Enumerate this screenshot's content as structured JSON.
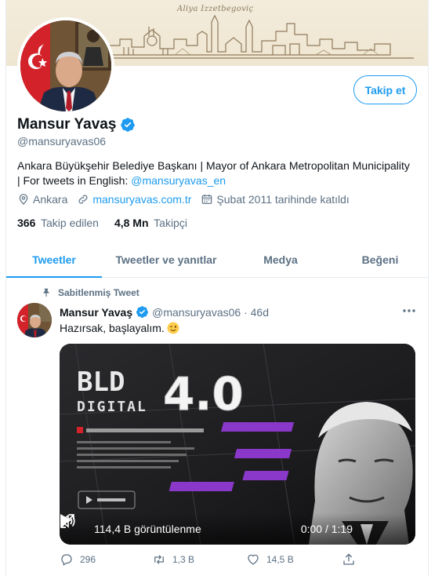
{
  "banner": {
    "caption": "Aliya Izzetbegoviç"
  },
  "profile": {
    "name": "Mansur Yavaş",
    "handle": "@mansuryavas06",
    "follow_label": "Takip et",
    "bio_text": "Ankara Büyükşehir Belediye Başkanı | Mayor of Ankara Metropolitan Municipality | For tweets in English: ",
    "bio_link": "@mansuryavas_en",
    "location": "Ankara",
    "website": "mansuryavas.com.tr",
    "joined": "Şubat 2011 tarihinde katıldı",
    "following_count": "366",
    "following_label": "Takip edilen",
    "followers_count": "4,8 Mn",
    "followers_label": "Takipçi"
  },
  "tabs": [
    {
      "label": "Tweetler",
      "active": true
    },
    {
      "label": "Tweetler ve yanıtlar",
      "active": false
    },
    {
      "label": "Medya",
      "active": false
    },
    {
      "label": "Beğeni",
      "active": false
    }
  ],
  "tweet": {
    "pinned_label": "Sabitlenmiş Tweet",
    "author": "Mansur Yavaş",
    "handle_time": "@mansuryavas06 · 46d",
    "text": "Hazırsak, başlayalım.",
    "emoji": "winking-face",
    "video": {
      "title_line1": "BLD",
      "title_line2": "DIGITAL",
      "title_big": "4.0",
      "views": "114,4 B görüntülenme",
      "time": "0:00 / 1:19"
    },
    "replies": "296",
    "retweets": "1,3 B",
    "likes": "14,5 B"
  },
  "colors": {
    "accent": "#1d9bf0",
    "secondary_text": "#5b7083",
    "border": "#e6ecf0"
  }
}
